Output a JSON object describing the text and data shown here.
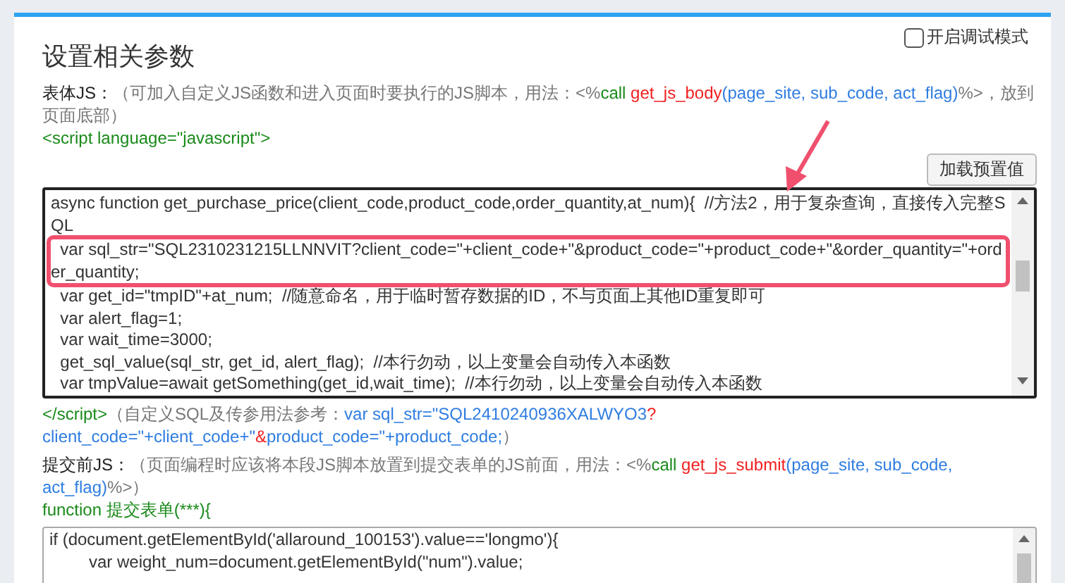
{
  "title": "设置相关参数",
  "debug_toggle": {
    "label": "开启调试模式",
    "checked": false
  },
  "body_js": {
    "intro": [
      {
        "kind": "label",
        "text": "表体JS："
      },
      {
        "kind": "note",
        "text": "（可加入自定义JS函数和进入页面时要执行的JS脚本，用法：<%"
      },
      {
        "kind": "keyword",
        "text": "call "
      },
      {
        "kind": "func",
        "text": "get_js_body"
      },
      {
        "kind": "param",
        "text": "(page_site, sub_code, act_flag)"
      },
      {
        "kind": "note",
        "text": "%>，放到页面底部）"
      }
    ],
    "open_tag": "<script language=\"javascript\">",
    "load_button": "加载预置值",
    "code_lines": [
      {
        "text": "async function get_purchase_price(client_code,product_code,order_quantity,at_num){  //方法2，用于复杂查询，直接传入完整SQL",
        "highlighted": false
      },
      {
        "text": "  var sql_str=\"SQL2310231215LLNNVIT?client_code=\"+client_code+\"&product_code=\"+product_code+\"&order_quantity=\"+order_quantity;",
        "highlighted": true
      },
      {
        "text": "  var get_id=\"tmpID\"+at_num;  //随意命名，用于临时暂存数据的ID，不与页面上其他ID重复即可",
        "highlighted": false
      },
      {
        "text": "  var alert_flag=1;",
        "highlighted": false
      },
      {
        "text": "  var wait_time=3000;",
        "highlighted": false
      },
      {
        "text": "  get_sql_value(sql_str, get_id, alert_flag);  //本行勿动，以上变量会自动传入本函数",
        "highlighted": false
      },
      {
        "text": "  var tmpValue=await getSomething(get_id,wait_time);  //本行勿动，以上变量会自动传入本函数",
        "highlighted": false
      }
    ],
    "close_note": [
      {
        "kind": "tag",
        "text": "</script>"
      },
      {
        "kind": "note",
        "text": "（自定义SQL及传参用法参考："
      },
      {
        "kind": "param",
        "text": "var sql_str=\"SQL2410240936XALWYO3"
      },
      {
        "kind": "func",
        "text": "?"
      },
      {
        "kind": "param",
        "text": "client_code=\"+client_code+\""
      },
      {
        "kind": "func",
        "text": "&"
      },
      {
        "kind": "param",
        "text": "product_code=\"+product_code;"
      },
      {
        "kind": "note",
        "text": "）"
      }
    ]
  },
  "submit_js": {
    "intro": [
      {
        "kind": "label",
        "text": "提交前JS："
      },
      {
        "kind": "note",
        "text": "（页面编程时应该将本段JS脚本放置到提交表单的JS前面，用法：<%"
      },
      {
        "kind": "keyword",
        "text": "call "
      },
      {
        "kind": "func",
        "text": "get_js_submit"
      },
      {
        "kind": "param",
        "text": "(page_site, sub_code, act_flag)"
      },
      {
        "kind": "note",
        "text": "%>）"
      }
    ],
    "function_header": "function 提交表单(***){",
    "code_lines": [
      {
        "text": "if (document.getElementById('allaround_100153').value=='longmo'){",
        "children": [
          {
            "text": "var weight_num=document.getElementById(\"num\").value;"
          }
        ]
      }
    ]
  }
}
